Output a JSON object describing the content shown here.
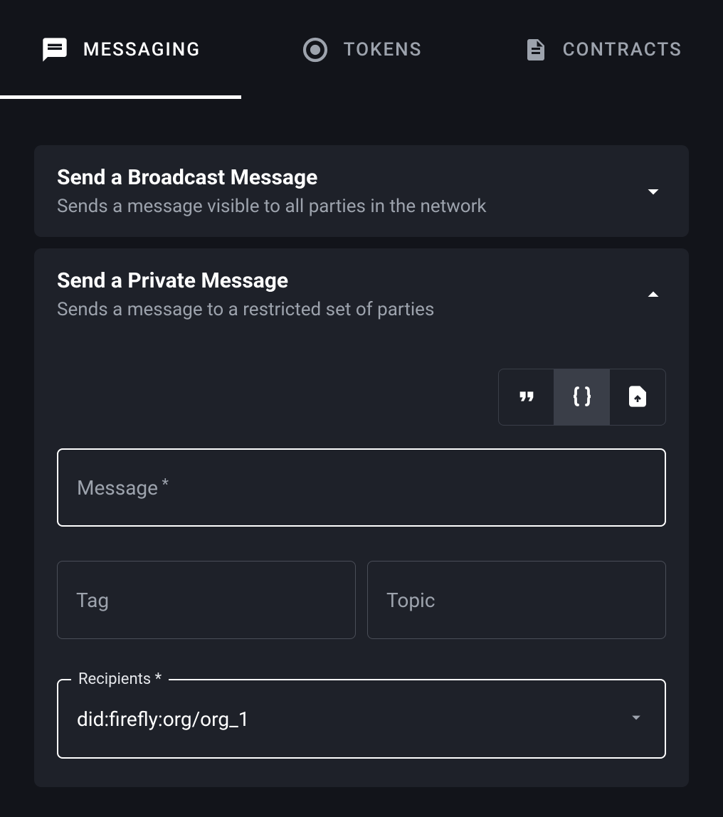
{
  "tabs": {
    "messaging": "MESSAGING",
    "tokens": "TOKENS",
    "contracts": "CONTRACTS",
    "active": "messaging"
  },
  "panels": {
    "broadcast": {
      "title": "Send a Broadcast Message",
      "subtitle": "Sends a message visible to all parties in the network",
      "expanded": false
    },
    "private": {
      "title": "Send a Private Message",
      "subtitle": "Sends a message to a restricted set of parties",
      "expanded": true
    }
  },
  "formatToggle": {
    "options": [
      "quote",
      "json",
      "file"
    ],
    "active": "json"
  },
  "fields": {
    "message": {
      "label": "Message",
      "required": true,
      "value": ""
    },
    "tag": {
      "label": "Tag",
      "required": false,
      "value": ""
    },
    "topic": {
      "label": "Topic",
      "required": false,
      "value": ""
    },
    "recipients": {
      "label": "Recipients",
      "required": true,
      "value": "did:firefly:org/org_1"
    }
  }
}
